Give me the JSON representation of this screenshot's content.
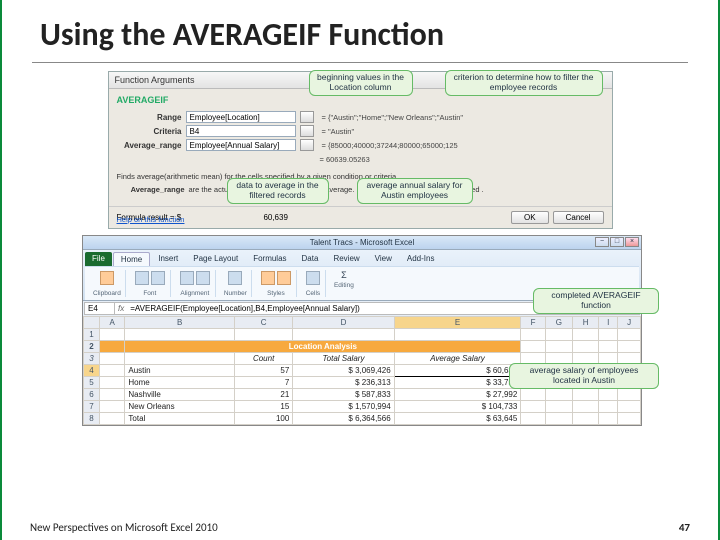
{
  "title": "Using the AVERAGEIF Function",
  "dialog": {
    "title": "Function Arguments",
    "fn": "AVERAGEIF",
    "range_lbl": "Range",
    "range_val": "Employee[Location]",
    "range_res": "= {\"Austin\";\"Home\";\"New Orleans\";\"Austin\"",
    "criteria_lbl": "Criteria",
    "criteria_val": "B4",
    "criteria_res": "= \"Austin\"",
    "avgrange_lbl": "Average_range",
    "avgrange_val": "Employee[Annual Salary]",
    "avgrange_res": "= {85000;40000;37244;80000;65000;125",
    "result_eq": "= 60639.05263",
    "desc": "Finds average(arithmetic mean) for the cells specified by a given condition or criteria.",
    "arg_name": "Average_range",
    "arg_desc": "are the actual cells to be used to find the average. If omitted, the cells in range are used .",
    "formula_result_lbl": "Formula result =  $",
    "formula_result_val": "60,639",
    "help": "Help on this function",
    "ok": "OK",
    "cancel": "Cancel"
  },
  "callouts": {
    "c1": "beginning values in\nthe Location column",
    "c2": "criterion to determine how to\nfilter the employee records",
    "c3": "data to average in\nthe filtered records",
    "c4": "average annual salary\nfor Austin employees",
    "c5": "completed AVERAGEIF\nfunction",
    "c6": "average salary of employees\nlocated in Austin"
  },
  "excel": {
    "title": "Talent Tracs - Microsoft Excel",
    "tabs": [
      "File",
      "Home",
      "Insert",
      "Page Layout",
      "Formulas",
      "Data",
      "Review",
      "View",
      "Add-Ins"
    ],
    "groups": [
      "Clipboard",
      "Font",
      "Alignment",
      "Number",
      "Styles",
      "Cells",
      "Editing"
    ],
    "namebox": "E4",
    "formula": "=AVERAGEIF(Employee[Location],B4,Employee[Annual Salary])",
    "cols": [
      "",
      "A",
      "B",
      "C",
      "D",
      "E",
      "F",
      "G",
      "H",
      "I",
      "J"
    ],
    "hdr": "Location Analysis",
    "sub_count": "Count",
    "sub_total": "Total Salary",
    "sub_avg": "Average\nSalary",
    "rows": [
      {
        "n": "4",
        "loc": "Austin",
        "cnt": "57",
        "tot": "$ 3,069,426",
        "avg": "$    60,639"
      },
      {
        "n": "5",
        "loc": "Home",
        "cnt": "7",
        "tot": "$    236,313",
        "avg": "$    33,759"
      },
      {
        "n": "6",
        "loc": "Nashville",
        "cnt": "21",
        "tot": "$    587,833",
        "avg": "$    27,992"
      },
      {
        "n": "7",
        "loc": "New Orleans",
        "cnt": "15",
        "tot": "$ 1,570,994",
        "avg": "$  104,733"
      },
      {
        "n": "8",
        "loc": "Total",
        "cnt": "100",
        "tot": "$ 6,364,566",
        "avg": "$    63,645"
      }
    ]
  },
  "footer": {
    "left": "New Perspectives on Microsoft Excel 2010",
    "page": "47"
  }
}
